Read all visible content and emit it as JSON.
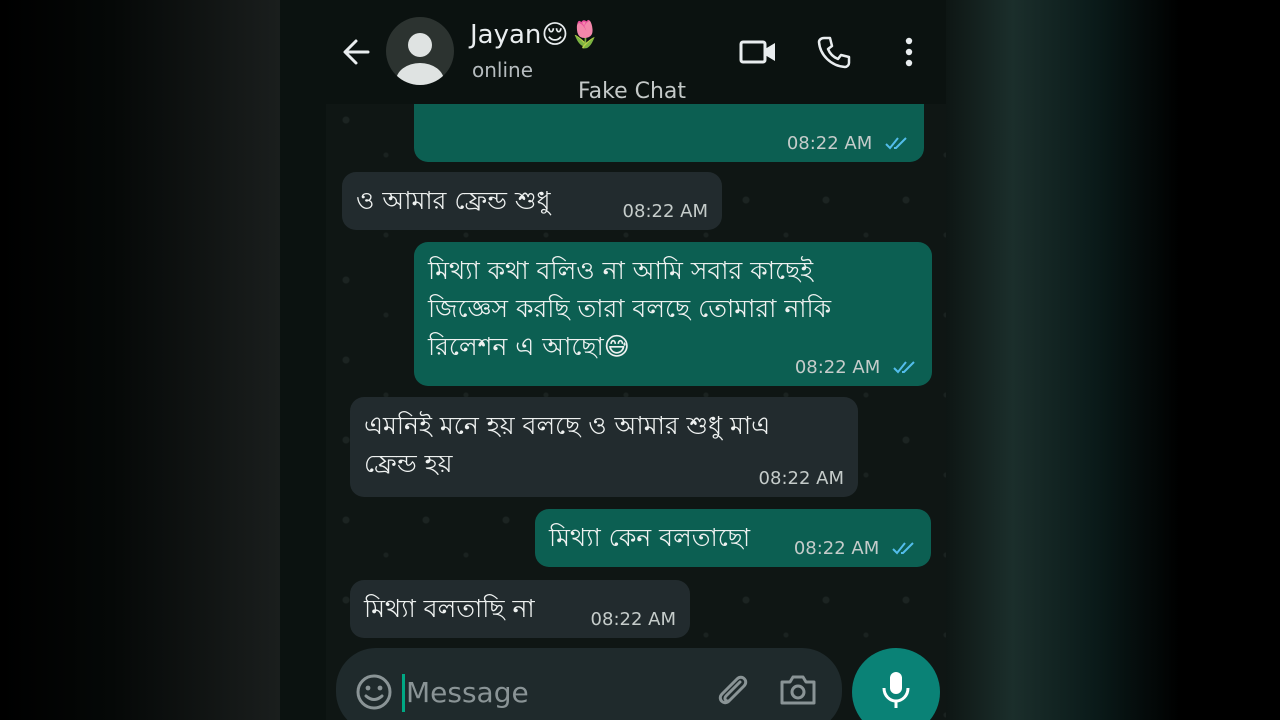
{
  "header": {
    "contact_name": "Jayan😌🌷",
    "contact_status": "online",
    "watermark": "Fake Chat"
  },
  "messages": [
    {
      "direction": "outgoing",
      "text": "",
      "time": "08:22 AM",
      "read": true
    },
    {
      "direction": "incoming",
      "text": "ও আমার ফ্রেন্ড শুধু",
      "time": "08:22 AM"
    },
    {
      "direction": "outgoing",
      "lines": [
        "মিথ্যা কথা বলিও না আমি সবার কাছেই",
        "জিজ্ঞেস করছি তারা বলছে তোমারা নাকি",
        "রিলেশন এ আছো😅"
      ],
      "time": "08:22 AM",
      "read": true
    },
    {
      "direction": "incoming",
      "lines": [
        "এমনিই মনে হয় বলছে ও আমার শুধু মাএ",
        "ফ্রেন্ড হয়"
      ],
      "time": "08:22 AM"
    },
    {
      "direction": "outgoing",
      "text": "মিথ্যা কেন বলতাছো",
      "time": "08:22 AM",
      "read": true
    },
    {
      "direction": "incoming",
      "text": "মিথ্যা বলতাছি না",
      "time": "08:22 AM"
    }
  ],
  "composer": {
    "placeholder": "Message"
  },
  "colors": {
    "outgoing_bubble": "#0c5f52",
    "incoming_bubble": "#222b2e",
    "read_tick": "#53bdeb",
    "mic_button": "#0a8276"
  },
  "icons": [
    "back-arrow-icon",
    "avatar-icon",
    "video-call-icon",
    "phone-icon",
    "more-vert-icon",
    "double-check-icon",
    "emoji-icon",
    "attach-icon",
    "camera-icon",
    "mic-icon"
  ]
}
